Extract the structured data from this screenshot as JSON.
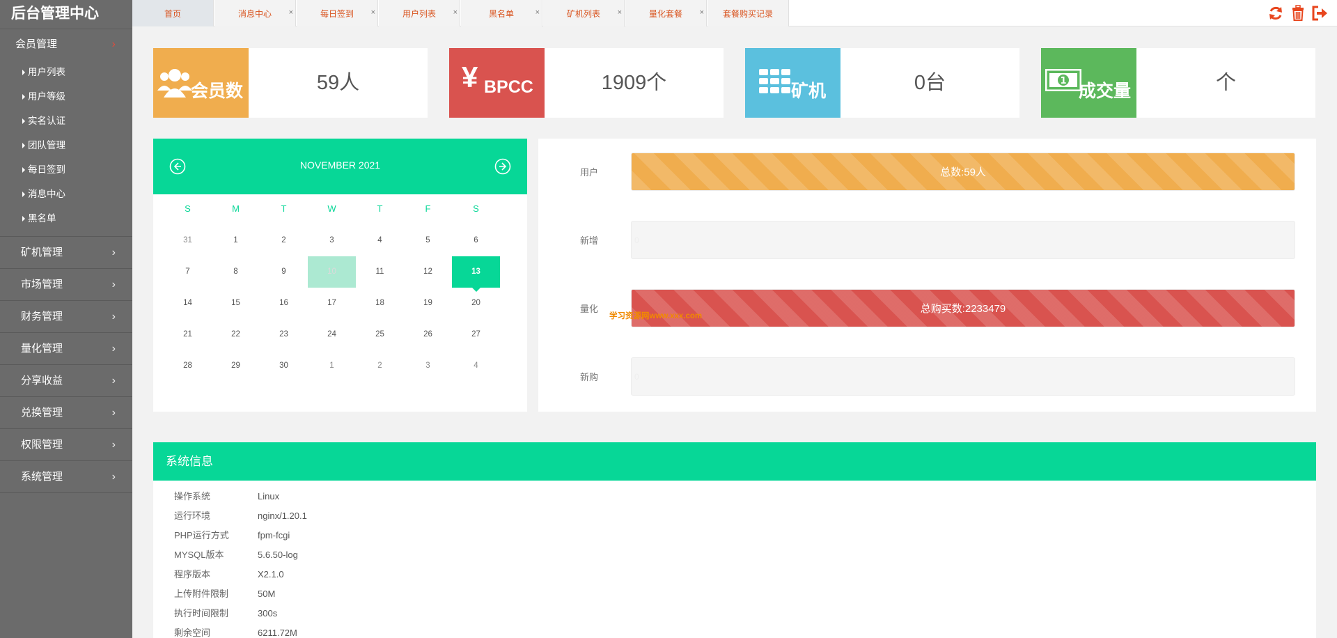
{
  "app": {
    "title": "后台管理中心"
  },
  "sidebar": {
    "open_group": {
      "label": "会员管理",
      "items": [
        "用户列表",
        "用户等级",
        "实名认证",
        "团队管理",
        "每日签到",
        "消息中心",
        "黑名单"
      ]
    },
    "groups": [
      "矿机管理",
      "市场管理",
      "财务管理",
      "量化管理",
      "分享收益",
      "兑换管理",
      "权限管理",
      "系统管理"
    ]
  },
  "tabs": [
    {
      "label": "首页",
      "active": true,
      "closable": false
    },
    {
      "label": "消息中心",
      "closable": true
    },
    {
      "label": "每日签到",
      "closable": true
    },
    {
      "label": "用户列表",
      "closable": true
    },
    {
      "label": "黑名单",
      "closable": true
    },
    {
      "label": "矿机列表",
      "closable": true
    },
    {
      "label": "量化套餐",
      "closable": true
    },
    {
      "label": "套餐购买记录",
      "closable": true
    }
  ],
  "toolbar": {
    "close_tab": "×",
    "icons": [
      "refresh-icon",
      "trash-icon",
      "logout-icon"
    ]
  },
  "stats": [
    {
      "label": "会员数",
      "value": "59人",
      "color": "#f0ad4e",
      "icon": "users-icon"
    },
    {
      "label": "BPCC",
      "symbol": "¥",
      "value": "1909个",
      "color": "#d9534f",
      "icon": "yen-icon"
    },
    {
      "label": "矿机",
      "value": "0台",
      "color": "#5bc0de",
      "icon": "grid-icon"
    },
    {
      "label": "成交量",
      "value": "个",
      "color": "#5cb85c",
      "icon": "money-icon"
    }
  ],
  "calendar": {
    "title": "NOVEMBER 2021",
    "weekdays": [
      "S",
      "M",
      "T",
      "W",
      "T",
      "F",
      "S"
    ],
    "weeks": [
      [
        "31",
        "1",
        "2",
        "3",
        "4",
        "5",
        "6"
      ],
      [
        "7",
        "8",
        "9",
        "10",
        "11",
        "12",
        "13"
      ],
      [
        "14",
        "15",
        "16",
        "17",
        "18",
        "19",
        "20"
      ],
      [
        "21",
        "22",
        "23",
        "24",
        "25",
        "26",
        "27"
      ],
      [
        "28",
        "29",
        "30",
        "1",
        "2",
        "3",
        "4"
      ]
    ],
    "highlighted_day": "10",
    "selected_day": "13",
    "accent_color": "#07d797"
  },
  "progress": {
    "rows": [
      {
        "label": "用户",
        "text": "总数:59人",
        "fill_percent": 100,
        "style": "orange"
      },
      {
        "label": "新增",
        "text": "0",
        "fill_percent": 0,
        "style": "empty"
      },
      {
        "label": "量化",
        "text": "总购买数:2233479",
        "fill_percent": 100,
        "style": "red"
      },
      {
        "label": "新购",
        "text": "0",
        "fill_percent": 0,
        "style": "empty"
      }
    ],
    "watermark": "学习资源网www.xxx.com"
  },
  "sysinfo": {
    "title": "系统信息",
    "rows": [
      {
        "key": "操作系统",
        "value": "Linux"
      },
      {
        "key": "运行环境",
        "value": "nginx/1.20.1"
      },
      {
        "key": "PHP运行方式",
        "value": "fpm-fcgi"
      },
      {
        "key": "MYSQL版本",
        "value": "5.6.50-log"
      },
      {
        "key": "程序版本",
        "value": "X2.1.0"
      },
      {
        "key": "上传附件限制",
        "value": "50M"
      },
      {
        "key": "执行时间限制",
        "value": "300s"
      },
      {
        "key": "剩余空间",
        "value": "6211.72M"
      }
    ]
  }
}
